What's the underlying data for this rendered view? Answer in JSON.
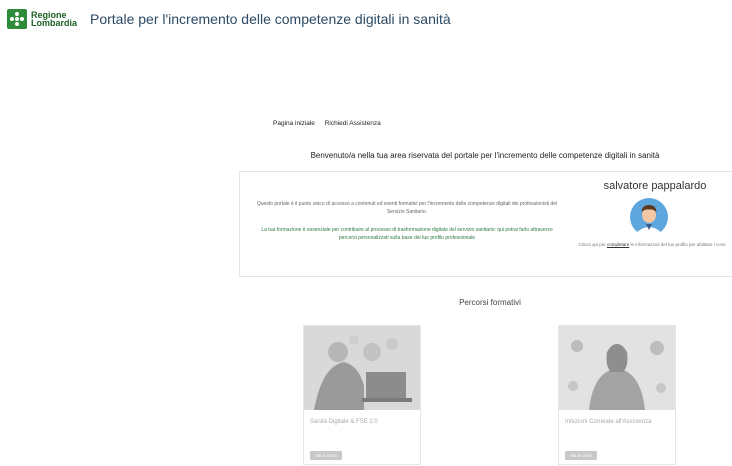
{
  "header": {
    "logo_line1": "Regione",
    "logo_line2": "Lombardia",
    "title": "Portale per l'incremento delle competenze digitali in sanità"
  },
  "nav": {
    "home": "Pagina iniziale",
    "support": "Richiedi Assistenza"
  },
  "welcome": "Benvenuto/a nella tua area riservata del portale per l'incremento delle competenze digitali in sanità",
  "card": {
    "intro": "Questo portale è il punto unico di accesso a contenuti ed eventi formativi per l'incremento delle competenze digitali dei professionisti del Servizio Sanitario.",
    "intro_green": "La tua formazione è essenziale per contribuire al processo di trasformazione digitale del servizio sanitario: qui potrai farlo attraverso percorsi personalizzati sulla base del tuo profilo professionale",
    "user_name": "salvatore pappalardo",
    "profile_prefix": "Clicca qui per ",
    "profile_link": "completare",
    "profile_suffix": " le informazioni del tuo profilo per abilitare i corsi"
  },
  "section_title": "Percorsi formativi",
  "courses": [
    {
      "title": "Sanità Digitale & FSE 2.0",
      "button": "Vai ai corsi"
    },
    {
      "title": "Infezioni Correlate all'Assistenza",
      "button": "Vai ai corsi"
    }
  ],
  "colors": {
    "brand_green": "#2e8b3a",
    "title_blue": "#2b4a65",
    "intro_green": "#2f7a3e"
  },
  "icons": [
    "regione-lombardia-logo",
    "user-avatar-icon"
  ]
}
